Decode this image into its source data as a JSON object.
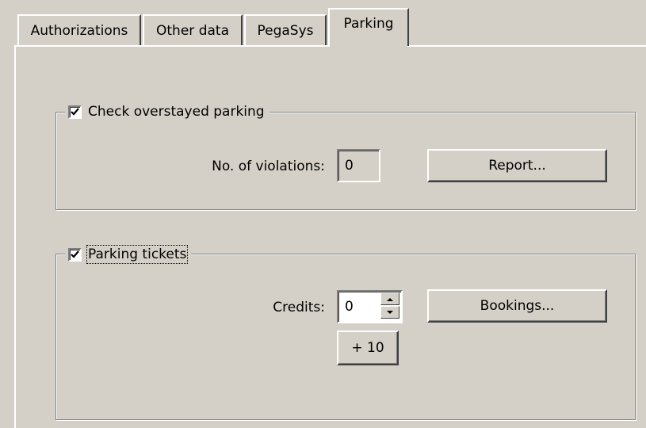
{
  "tabs": [
    {
      "label": "Authorizations",
      "active": false
    },
    {
      "label": "Other data",
      "active": false
    },
    {
      "label": "PegaSys",
      "active": false
    },
    {
      "label": "Parking",
      "active": true
    }
  ],
  "overstayed_group": {
    "label": "Check overstayed parking",
    "checked": true,
    "violations_label": "No. of violations:",
    "violations_value": "0",
    "report_button": "Report..."
  },
  "tickets_group": {
    "label": "Parking tickets",
    "checked": true,
    "credits_label": "Credits:",
    "credits_value": "0",
    "bookings_button": "Bookings...",
    "plus_button": "+ 10"
  },
  "icons": {
    "checkmark": "checkmark-icon",
    "spin_up": "spin-up-icon",
    "spin_down": "spin-down-icon"
  }
}
